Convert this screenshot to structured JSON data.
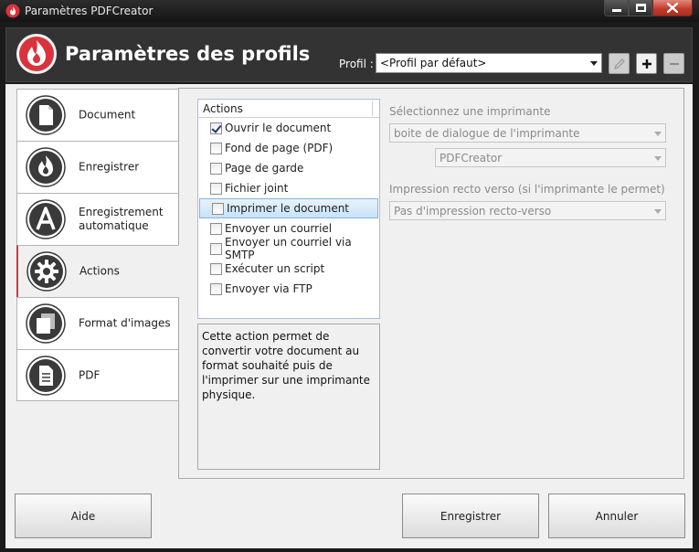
{
  "window": {
    "title": "Paramètres PDFCreator"
  },
  "header": {
    "title": "Paramètres des profils",
    "profile_label": "Profil :",
    "profile_value": "<Profil par défaut>"
  },
  "sidebar": {
    "items": [
      {
        "label": "Document",
        "icon": "document-icon"
      },
      {
        "label": "Enregistrer",
        "icon": "fire-icon"
      },
      {
        "label": "Enregistrement automatique",
        "icon": "auto-save-icon"
      },
      {
        "label": "Actions",
        "icon": "gear-icon",
        "active": true
      },
      {
        "label": "Format d'images",
        "icon": "image-format-icon"
      },
      {
        "label": "PDF",
        "icon": "pdf-icon"
      }
    ]
  },
  "actions": {
    "header": "Actions",
    "items": [
      {
        "label": "Ouvrir le document",
        "checked": true
      },
      {
        "label": "Fond de page (PDF)",
        "checked": false
      },
      {
        "label": "Page de garde",
        "checked": false
      },
      {
        "label": "Fichier joint",
        "checked": false
      },
      {
        "label": "Imprimer le document",
        "checked": false,
        "selected": true
      },
      {
        "label": "Envoyer un courriel",
        "checked": false
      },
      {
        "label": "Envoyer un courriel via SMTP",
        "checked": false
      },
      {
        "label": "Exécuter un script",
        "checked": false
      },
      {
        "label": "Envoyer via FTP",
        "checked": false
      }
    ],
    "description": "Cette action permet de convertir votre document au format souhaité puis de l'imprimer sur une imprimante physique."
  },
  "printer": {
    "select_label": "Sélectionnez une imprimante",
    "mode_value": "boite de dialogue de l'imprimante",
    "printer_value": "PDFCreator",
    "duplex_label": "Impression recto verso (si l'imprimante le permet)",
    "duplex_value": "Pas d'impression recto-verso"
  },
  "buttons": {
    "help": "Aide",
    "save": "Enregistrer",
    "cancel": "Annuler"
  },
  "colors": {
    "accent": "#d9343e",
    "header_bg": "#333333"
  }
}
